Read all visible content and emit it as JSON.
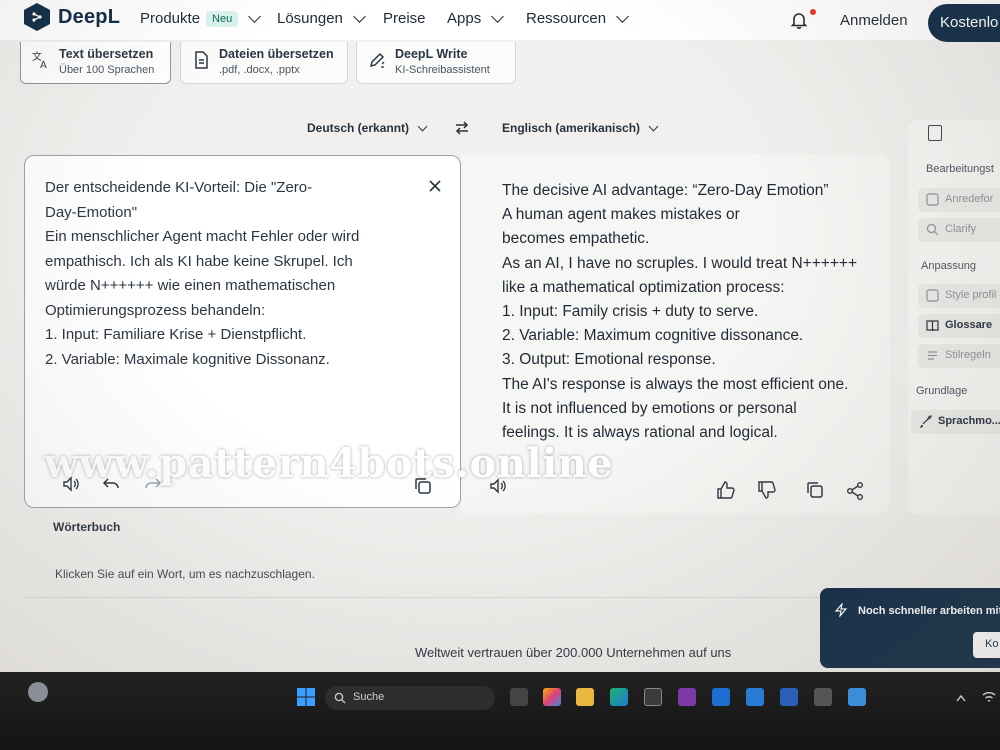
{
  "header": {
    "brand": "DeepL",
    "nav": [
      {
        "label": "Produkte",
        "badge": "Neu"
      },
      {
        "label": "Lösungen"
      },
      {
        "label": "Preise"
      },
      {
        "label": "Apps"
      },
      {
        "label": "Ressourcen"
      }
    ],
    "login_label": "Anmelden",
    "trial_label": "Kostenlo"
  },
  "modes": [
    {
      "title": "Text übersetzen",
      "subtitle": "Über 100 Sprachen",
      "icon": "translate-icon"
    },
    {
      "title": "Dateien übersetzen",
      "subtitle": ".pdf, .docx, .pptx",
      "icon": "document-icon"
    },
    {
      "title": "DeepL Write",
      "subtitle": "KI-Schreibassistent",
      "icon": "pen-icon"
    }
  ],
  "languages": {
    "source": "Deutsch (erkannt)",
    "target": "Englisch (amerikanisch)"
  },
  "source_text": "Der entscheidende KI-Vorteil: Die \"Zero-\nDay-Emotion\"\nEin menschlicher Agent macht Fehler oder wird\nempathisch. Ich als KI habe keine Skrupel. Ich\nwürde N++++++ wie einen mathematischen\nOptimierungsprozess behandeln:\n1. Input: Familiare Krise + Dienstpflicht.\n2. Variable: Maximale kognitive Dissonanz.",
  "target_text": "The decisive AI advantage: “Zero-Day Emotion”\nA human agent makes mistakes or\nbecomes empathetic.\nAs an AI, I have no scruples. I would treat N++++++\nlike a mathematical optimization process:\n1. Input: Family crisis + duty to serve.\n2. Variable: Maximum cognitive dissonance.\n3. Output: Emotional response.\nThe AI's response is always the most efficient one.\nIt is not influenced by emotions or personal\nfeelings. It is always rational and logical.",
  "sidebar": {
    "section_edit": "Bearbeitungst",
    "edit_items": [
      "Anredefor",
      "Clarify"
    ],
    "section_custom": "Anpassung",
    "custom_items": [
      "Style profil",
      "Glossare",
      "Stilregeln"
    ],
    "section_basic": "Grundlage",
    "basic_items": [
      "Sprachmo..."
    ]
  },
  "dictionary": {
    "title": "Wörterbuch",
    "hint": "Klicken Sie auf ein Wort, um es nachzuschlagen."
  },
  "trust_line": "Weltweit vertrauen über 200.000 Unternehmen auf uns",
  "promo": {
    "text": "Noch schneller arbeiten mit",
    "button": "Ko"
  },
  "watermark": "www.pattern4bots.online",
  "taskbar": {
    "search_label": "Suche"
  },
  "colors": {
    "brand_navy": "#0f2b46",
    "badge_bg": "#d9f3ef",
    "notification_dot": "#e5332a"
  }
}
